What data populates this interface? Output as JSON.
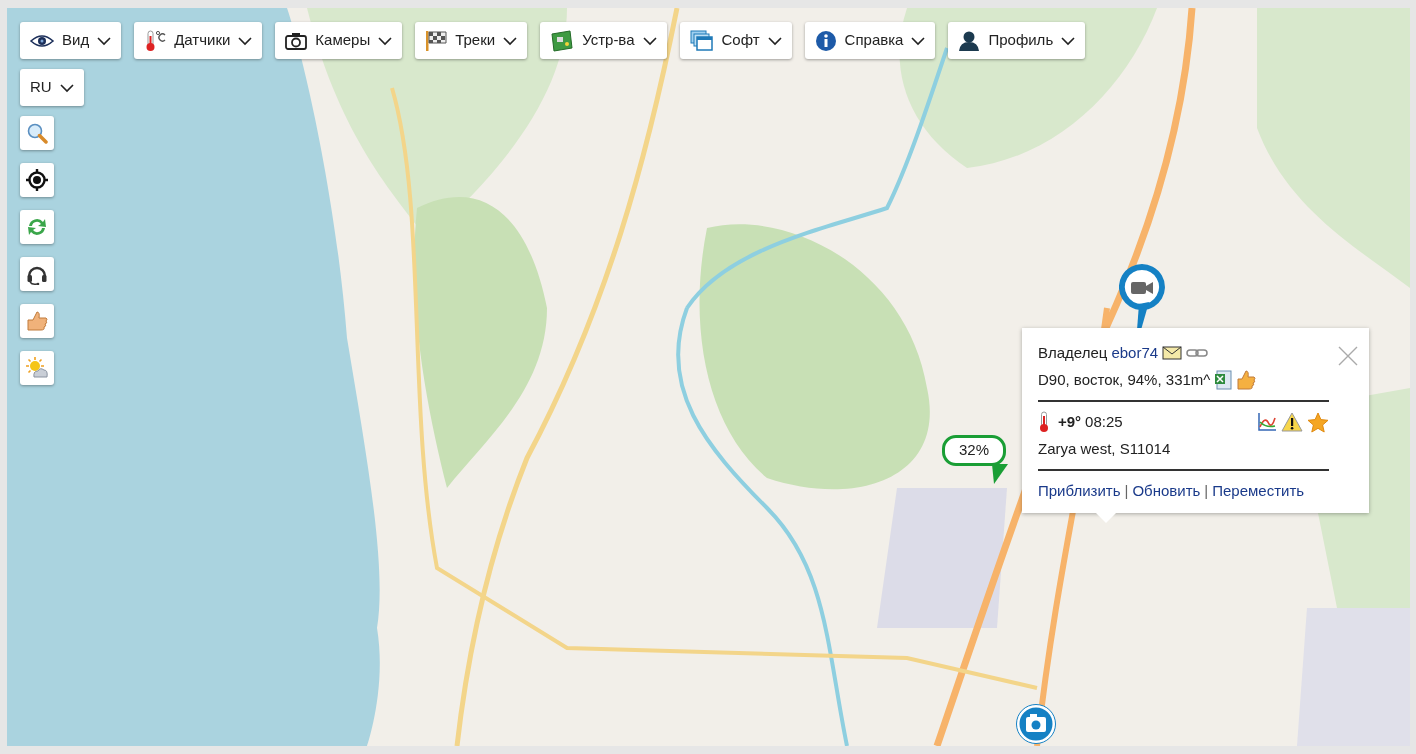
{
  "menu": [
    {
      "label": "Вид"
    },
    {
      "label": "Датчики"
    },
    {
      "label": "Камеры"
    },
    {
      "label": "Треки"
    },
    {
      "label": "Устр-ва"
    },
    {
      "label": "Софт"
    },
    {
      "label": "Справка"
    },
    {
      "label": "Профиль"
    }
  ],
  "language": {
    "label": "RU"
  },
  "marker_badge": {
    "label": "32%"
  },
  "popup": {
    "owner_label": "Владелец",
    "owner": "ebor74",
    "details": "D90, восток, 94%, 331m^",
    "temperature": "+9°",
    "time": "08:25",
    "location": "Zarya west, S11014",
    "links": [
      "Приблизить",
      "Обновить",
      "Переместить"
    ],
    "link_separators": [
      "|",
      "|"
    ]
  }
}
